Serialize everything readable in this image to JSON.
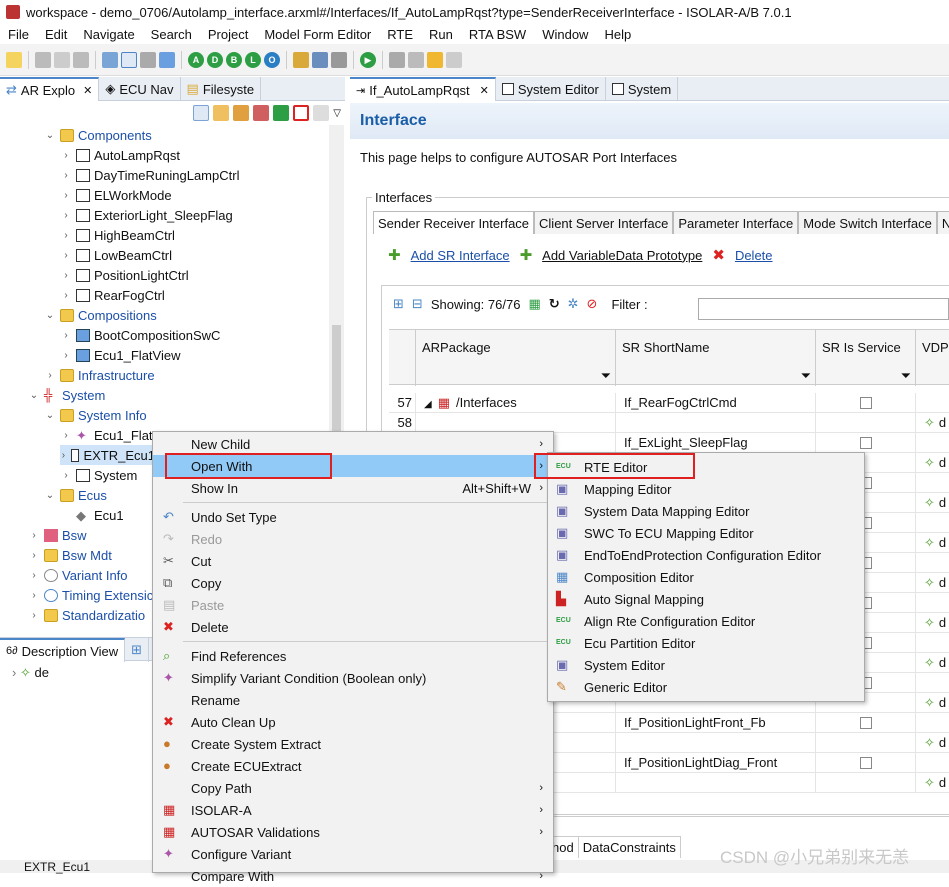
{
  "title": "workspace - demo_0706/Autolamp_interface.arxml#/Interfaces/If_AutoLampRqst?type=SenderReceiverInterface - ISOLAR-A/B 7.0.1",
  "menu": [
    "File",
    "Edit",
    "Navigate",
    "Search",
    "Project",
    "Model Form Editor",
    "RTE",
    "Run",
    "RTA BSW",
    "Window",
    "Help"
  ],
  "left_tabs": [
    "AR Explo",
    "ECU Nav",
    "Filesyste"
  ],
  "tree": [
    {
      "label": "Components",
      "level": 3,
      "expanded": true
    },
    {
      "label": "AutoLampRqst",
      "level": 4
    },
    {
      "label": "DayTimeRuningLampCtrl",
      "level": 4
    },
    {
      "label": "ELWorkMode",
      "level": 4
    },
    {
      "label": "ExteriorLight_SleepFlag",
      "level": 4
    },
    {
      "label": "HighBeamCtrl",
      "level": 4
    },
    {
      "label": "LowBeamCtrl",
      "level": 4
    },
    {
      "label": "PositionLightCtrl",
      "level": 4
    },
    {
      "label": "RearFogCtrl",
      "level": 4
    },
    {
      "label": "Compositions",
      "level": 3,
      "expanded": true
    },
    {
      "label": "BootCompositionSwC",
      "level": 4
    },
    {
      "label": "Ecu1_FlatView",
      "level": 4
    },
    {
      "label": "Infrastructure",
      "level": 3
    },
    {
      "label": "System",
      "level": 2,
      "expanded": true
    },
    {
      "label": "System Info",
      "level": 3,
      "expanded": true
    },
    {
      "label": "Ecu1_FlatV",
      "level": 4
    },
    {
      "label": "EXTR_Ecu1",
      "level": 4
    },
    {
      "label": "System",
      "level": 4
    },
    {
      "label": "Ecus",
      "level": 3,
      "expanded": true
    },
    {
      "label": "Ecu1",
      "level": 4
    },
    {
      "label": "Bsw",
      "level": 2
    },
    {
      "label": "Bsw Mdt",
      "level": 2
    },
    {
      "label": "Variant Info",
      "level": 2
    },
    {
      "label": "Timing Extensic",
      "level": 2
    },
    {
      "label": "Standardizatio",
      "level": 2
    }
  ],
  "desc_tabs": [
    "Description View"
  ],
  "desc_item": "de",
  "status": "EXTR_Ecu1",
  "right_tabs": [
    "If_AutoLampRqst",
    "System Editor",
    "System"
  ],
  "page_title": "Interface",
  "help": "This page helps to configure AUTOSAR Port Interfaces",
  "group_label": "Interfaces",
  "sub_tabs": [
    "Sender Receiver Interface",
    "Client Server Interface",
    "Parameter Interface",
    "Mode Switch Interface",
    "N"
  ],
  "actions": {
    "add_sr": "Add SR Interface",
    "add_vdp": "Add VariableData Prototype",
    "delete": "Delete"
  },
  "showing": "Showing: 76/76",
  "filter_label": "Filter :",
  "columns": [
    "ARPackage",
    "SR ShortName",
    "SR Is Service",
    "VDP"
  ],
  "rows": [
    {
      "num": "57",
      "pkg": "/Interfaces",
      "name": "If_RearFogCtrlCmd",
      "chk": true,
      "vdp": ""
    },
    {
      "num": "58",
      "pkg": "",
      "name": "",
      "chk": false,
      "vdp": "d"
    },
    {
      "num": "",
      "pkg": "",
      "name": "If_ExLight_SleepFlag",
      "chk": true,
      "vdp": ""
    },
    {
      "num": "",
      "pkg": "",
      "name": "",
      "chk": false,
      "vdp": "d"
    },
    {
      "num": "",
      "pkg": "",
      "name": "",
      "chk": true,
      "vdp": ""
    },
    {
      "num": "",
      "pkg": "",
      "name": "",
      "chk": false,
      "vdp": "d"
    },
    {
      "num": "",
      "pkg": "",
      "name": "",
      "chk": true,
      "vdp": ""
    },
    {
      "num": "",
      "pkg": "",
      "name": "",
      "chk": false,
      "vdp": "d"
    },
    {
      "num": "",
      "pkg": "",
      "name": "",
      "chk": true,
      "vdp": ""
    },
    {
      "num": "",
      "pkg": "",
      "name": "",
      "chk": false,
      "vdp": "d"
    },
    {
      "num": "",
      "pkg": "",
      "name": "",
      "chk": true,
      "vdp": ""
    },
    {
      "num": "",
      "pkg": "",
      "name": "",
      "chk": false,
      "vdp": "d"
    },
    {
      "num": "",
      "pkg": "",
      "name": "",
      "chk": true,
      "vdp": ""
    },
    {
      "num": "",
      "pkg": "",
      "name": "",
      "chk": false,
      "vdp": "d"
    },
    {
      "num": "",
      "pkg": "",
      "name": "",
      "chk": true,
      "vdp": ""
    },
    {
      "num": "",
      "pkg": "",
      "name": "",
      "chk": false,
      "vdp": "d"
    },
    {
      "num": "",
      "pkg": "",
      "name": "If_PositionLightFront_Fb",
      "chk": true,
      "vdp": ""
    },
    {
      "num": "",
      "pkg": "",
      "name": "",
      "chk": false,
      "vdp": "d"
    },
    {
      "num": "",
      "pkg": "",
      "name": "If_PositionLightDiag_Front",
      "chk": true,
      "vdp": ""
    },
    {
      "num": "",
      "pkg": "",
      "name": "",
      "chk": false,
      "vdp": "d"
    }
  ],
  "bottom_tabs": [
    "hod",
    "DataConstraints"
  ],
  "watermark": "CSDN @小兄弟别来无恙",
  "context_menu": [
    {
      "label": "New Child",
      "sub": true
    },
    {
      "label": "Open With",
      "sub": true,
      "hl": true
    },
    {
      "label": "Show In",
      "shortcut": "Alt+Shift+W",
      "sub": true
    },
    {
      "sep": true
    },
    {
      "label": "Undo Set Type",
      "icon": "undo"
    },
    {
      "label": "Redo",
      "dis": true,
      "icon": "redo"
    },
    {
      "label": "Cut",
      "icon": "cut"
    },
    {
      "label": "Copy",
      "icon": "copy"
    },
    {
      "label": "Paste",
      "dis": true,
      "icon": "paste"
    },
    {
      "label": "Delete",
      "icon": "delete"
    },
    {
      "sep": true
    },
    {
      "label": "Find References",
      "icon": "find"
    },
    {
      "label": "Simplify Variant Condition (Boolean only)",
      "icon": "variant"
    },
    {
      "label": "Rename"
    },
    {
      "label": "Auto Clean Up",
      "icon": "clean"
    },
    {
      "label": "Create System Extract",
      "icon": "extract"
    },
    {
      "label": "Create ECUExtract",
      "icon": "ecuextract"
    },
    {
      "label": "Copy Path",
      "sub": true
    },
    {
      "label": "ISOLAR-A",
      "sub": true,
      "icon": "isolar"
    },
    {
      "label": "AUTOSAR Validations",
      "sub": true,
      "icon": "isolar"
    },
    {
      "label": "Configure Variant",
      "icon": "variant"
    },
    {
      "label": "Compare With",
      "sub": true
    }
  ],
  "open_with": [
    {
      "label": "RTE Editor",
      "icon": "ecu"
    },
    {
      "label": "Mapping Editor",
      "icon": "editor"
    },
    {
      "label": "System Data Mapping Editor",
      "icon": "editor"
    },
    {
      "label": "SWC To ECU Mapping Editor",
      "icon": "editor"
    },
    {
      "label": "EndToEndProtection Configuration Editor",
      "icon": "editor"
    },
    {
      "label": "Composition Editor",
      "icon": "composition"
    },
    {
      "label": "Auto Signal Mapping",
      "icon": "signal"
    },
    {
      "label": "Align Rte Configuration Editor",
      "icon": "ecu"
    },
    {
      "label": "Ecu Partition Editor",
      "icon": "ecu"
    },
    {
      "label": "System Editor",
      "icon": "editor"
    },
    {
      "label": "Generic Editor",
      "icon": "pencil"
    }
  ],
  "colors": {
    "highlight": "#91c9f7",
    "redbox": "#e02020",
    "link": "#1b4fa8"
  }
}
